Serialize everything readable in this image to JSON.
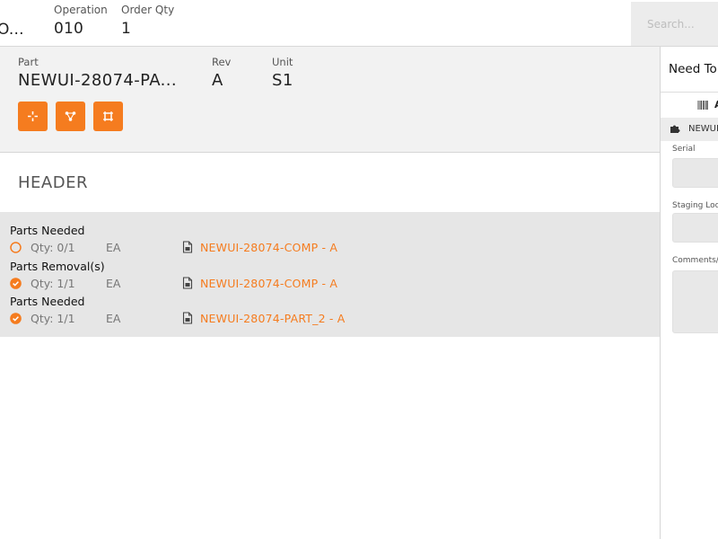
{
  "topbar": {
    "fields": [
      {
        "label": "",
        "value": "O..."
      },
      {
        "label": "Operation",
        "value": "010"
      },
      {
        "label": "Order Qty",
        "value": "1"
      }
    ],
    "search_placeholder": "Search..."
  },
  "part_panel": {
    "part": {
      "label": "Part",
      "value": "NEWUI-28074-PA..."
    },
    "rev": {
      "label": "Rev",
      "value": "A"
    },
    "unit": {
      "label": "Unit",
      "value": "S1"
    },
    "actions": [
      {
        "icon": "target-icon"
      },
      {
        "icon": "share-nodes-icon"
      },
      {
        "icon": "frame-icon"
      }
    ],
    "accent_color": "#f57c1f"
  },
  "section": {
    "title": "HEADER"
  },
  "parts_list": {
    "groups": [
      {
        "title": "Parts Needed",
        "row": {
          "status": "pending",
          "qty": "Qty: 0/1",
          "uom": "EA",
          "part": "NEWUI-28074-COMP - A"
        }
      },
      {
        "title": "Parts Removal(s)",
        "row": {
          "status": "complete",
          "qty": "Qty: 1/1",
          "uom": "EA",
          "part": "NEWUI-28074-COMP - A"
        }
      },
      {
        "title": "Parts Needed",
        "row": {
          "status": "complete",
          "qty": "Qty: 1/1",
          "uom": "EA",
          "part": "NEWUI-28074-PART_2 - A"
        }
      }
    ]
  },
  "right_panel": {
    "title": "Need To",
    "tab_label": "A",
    "item_label": "NEWUI",
    "fields": {
      "serial": "Serial",
      "staging": "Staging Locat",
      "comments": "Comments/op"
    }
  }
}
